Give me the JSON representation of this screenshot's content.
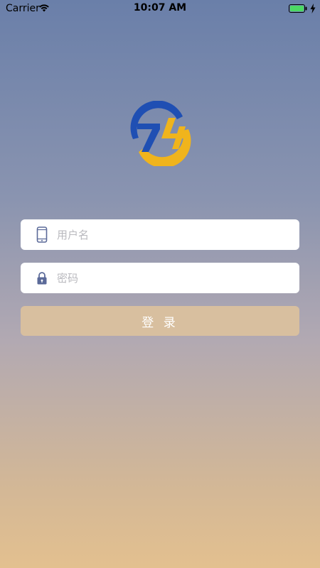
{
  "status_bar": {
    "carrier": "Carrier",
    "time": "10:07 AM",
    "battery_color": "#4cd964"
  },
  "logo": {
    "primary_color": "#1f4fb3",
    "secondary_color": "#f0b41c"
  },
  "form": {
    "username_placeholder": "用户名",
    "username_value": "",
    "password_placeholder": "密码",
    "password_value": "",
    "login_label": "登 录",
    "username_icon": "phone-icon",
    "password_icon": "lock-icon",
    "icon_color": "#5b6a99",
    "button_color": "#d8bf9f"
  }
}
